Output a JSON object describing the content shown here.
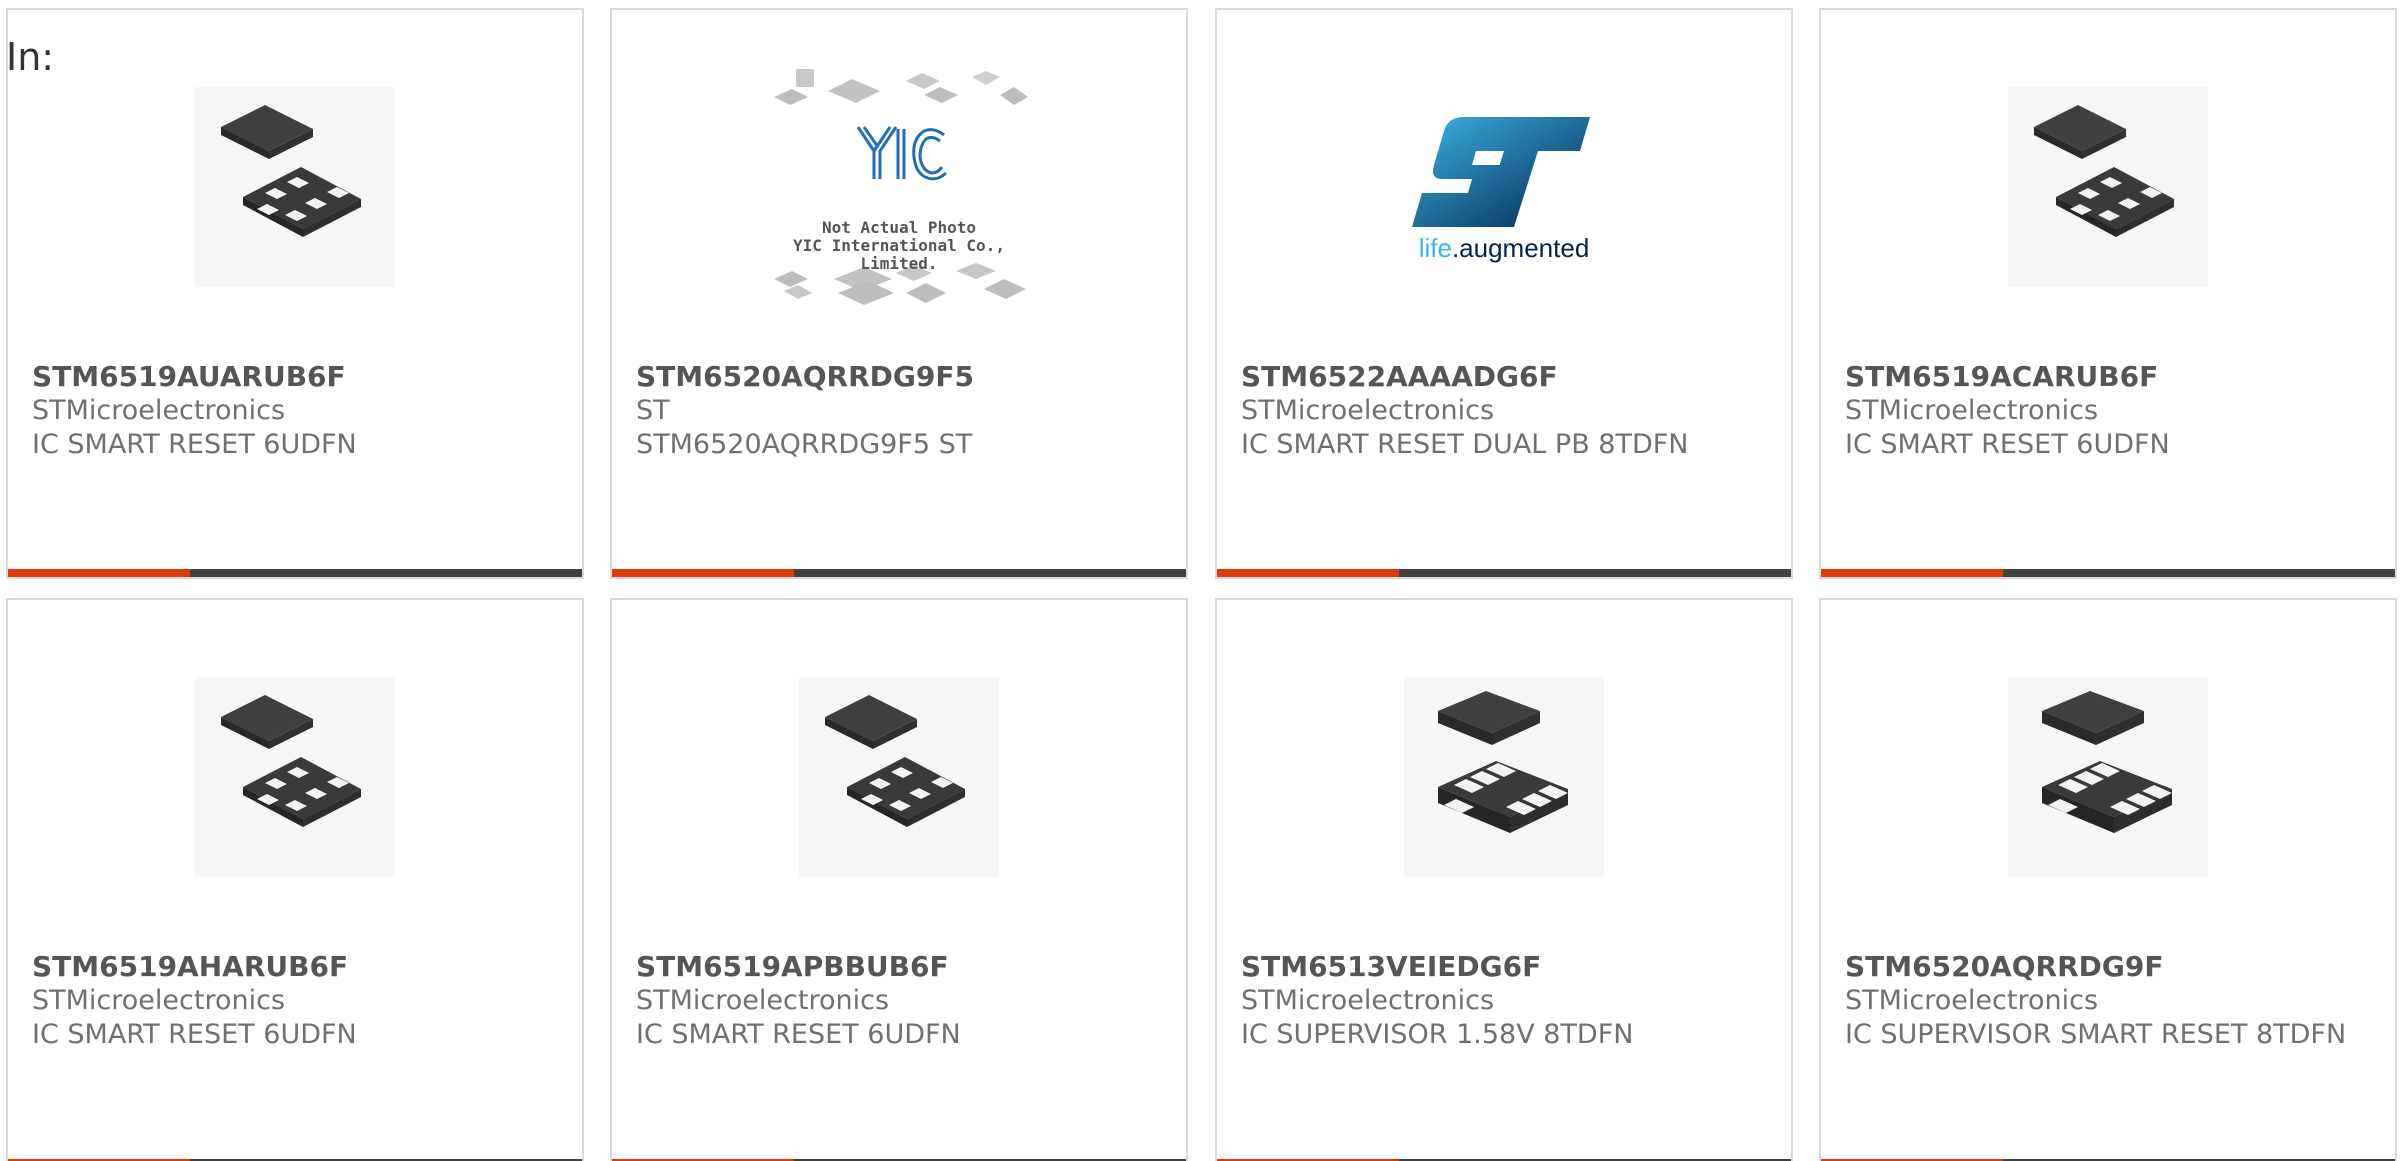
{
  "page_label": "In:",
  "colors": {
    "accent": "#dd3b0b",
    "bar": "#414141",
    "border": "#d9d9d9",
    "text": "#707070",
    "part_text": "#555555",
    "st_blue": "#1f8fcf"
  },
  "cards": [
    {
      "part_number": "STM6519AUARUB6F",
      "manufacturer": "STMicroelectronics",
      "description": "IC SMART RESET 6UDFN",
      "image": "udfn-6-package-icon"
    },
    {
      "part_number": "STM6520AQRRDG9F5",
      "manufacturer": "ST",
      "description": "STM6520AQRRDG9F5 ST",
      "image": "not-actual-photo-placeholder",
      "placeholder_caption_line1": "Not Actual Photo",
      "placeholder_caption_line2": "YIC International Co., Limited.",
      "placeholder_logo_text": "YIC"
    },
    {
      "part_number": "STM6522AAAADG6F",
      "manufacturer": "STMicroelectronics",
      "description": "IC SMART RESET DUAL PB 8TDFN",
      "image": "st-logo",
      "logo_tagline_life": "life",
      "logo_tagline_augmented": ".augmented"
    },
    {
      "part_number": "STM6519ACARUB6F",
      "manufacturer": "STMicroelectronics",
      "description": "IC SMART RESET 6UDFN",
      "image": "udfn-6-package-icon"
    },
    {
      "part_number": "STM6519AHARUB6F",
      "manufacturer": "STMicroelectronics",
      "description": "IC SMART RESET 6UDFN",
      "image": "udfn-6-package-icon"
    },
    {
      "part_number": "STM6519APBBUB6F",
      "manufacturer": "STMicroelectronics",
      "description": "IC SMART RESET 6UDFN",
      "image": "udfn-6-package-icon"
    },
    {
      "part_number": "STM6513VEIEDG6F",
      "manufacturer": "STMicroelectronics",
      "description": "IC SUPERVISOR 1.58V 8TDFN",
      "image": "tdfn-8-package-icon"
    },
    {
      "part_number": "STM6520AQRRDG9F",
      "manufacturer": "STMicroelectronics",
      "description": "IC SUPERVISOR SMART RESET 8TDFN",
      "image": "tdfn-8-package-icon"
    }
  ]
}
